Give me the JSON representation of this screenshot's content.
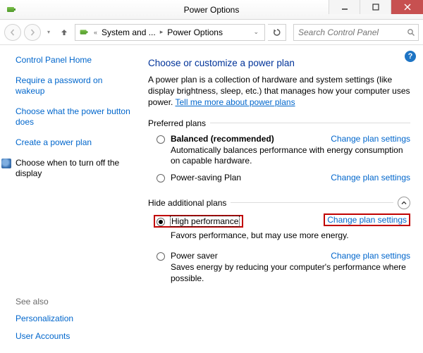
{
  "window": {
    "title": "Power Options"
  },
  "breadcrumb": {
    "seg1": "System and ...",
    "seg2": "Power Options"
  },
  "search": {
    "placeholder": "Search Control Panel"
  },
  "sidebar": {
    "home": "Control Panel Home",
    "items": [
      "Require a password on wakeup",
      "Choose what the power button does",
      "Create a power plan",
      "Choose when to turn off the display"
    ],
    "seealso_label": "See also",
    "seealso": [
      "Personalization",
      "User Accounts"
    ]
  },
  "main": {
    "heading": "Choose or customize a power plan",
    "desc_prefix": "A power plan is a collection of hardware and system settings (like display brightness, sleep, etc.) that manages how your computer uses power. ",
    "desc_link": "Tell me more about power plans",
    "preferred_label": "Preferred plans",
    "additional_label": "Hide additional plans",
    "change_label": "Change plan settings",
    "plans_preferred": [
      {
        "name": "Balanced (recommended)",
        "desc": "Automatically balances performance with energy consumption on capable hardware.",
        "bold": true,
        "selected": false
      },
      {
        "name": "Power-saving Plan",
        "desc": "",
        "bold": false,
        "selected": false
      }
    ],
    "plans_additional": [
      {
        "name": "High performance",
        "desc": "Favors performance, but may use more energy.",
        "bold": false,
        "selected": true,
        "highlight": true
      },
      {
        "name": "Power saver",
        "desc": "Saves energy by reducing your computer's performance where possible.",
        "bold": false,
        "selected": false
      }
    ]
  }
}
